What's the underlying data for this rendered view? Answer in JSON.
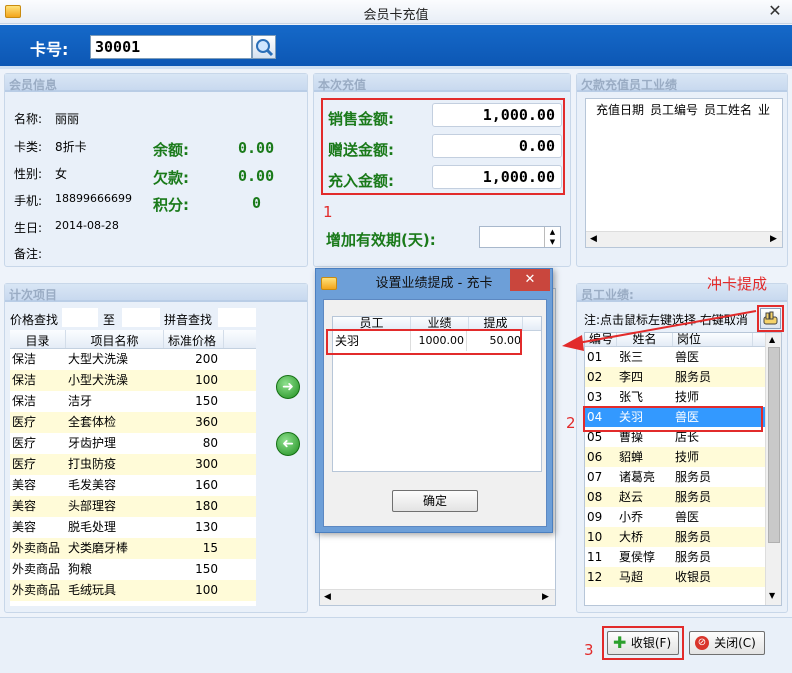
{
  "window": {
    "title": "会员卡充值",
    "close": "✕"
  },
  "card": {
    "label": "卡号:",
    "value": "30001"
  },
  "member": {
    "section": "会员信息",
    "name_label": "名称:",
    "name": "丽丽",
    "type_label": "卡类:",
    "type": "8折卡",
    "gender_label": "性别:",
    "gender": "女",
    "phone_label": "手机:",
    "phone": "18899666699",
    "birth_label": "生日:",
    "birth": "2014-08-28",
    "note_label": "备注:",
    "balance_label": "余额:",
    "balance": "0.00",
    "debt_label": "欠款:",
    "debt": "0.00",
    "points_label": "积分:",
    "points": "0"
  },
  "recharge": {
    "section": "本次充值",
    "sale_label": "销售金额:",
    "sale": "1,000.00",
    "gift_label": "赠送金额:",
    "gift": "0.00",
    "charge_label": "充入金额:",
    "charge": "1,000.00",
    "annot1": "1",
    "extend_label": "增加有效期(天):"
  },
  "debt_staff": {
    "section": "欠款充值员工业绩",
    "headers": [
      "充值日期",
      "员工编号",
      "员工姓名",
      "业"
    ]
  },
  "items": {
    "section": "计次项目",
    "price_search": "价格查找",
    "to": "至",
    "pinyin_search": "拼音查找",
    "headers": [
      "目录",
      "项目名称",
      "标准价格"
    ],
    "rows": [
      [
        "保洁",
        "大型犬洗澡",
        "200"
      ],
      [
        "保洁",
        "小型犬洗澡",
        "100"
      ],
      [
        "保洁",
        "洁牙",
        "150"
      ],
      [
        "医疗",
        "全套体检",
        "360"
      ],
      [
        "医疗",
        "牙齿护理",
        "80"
      ],
      [
        "医疗",
        "打虫防疫",
        "300"
      ],
      [
        "美容",
        "毛发美容",
        "160"
      ],
      [
        "美容",
        "头部理容",
        "180"
      ],
      [
        "美容",
        "脱毛处理",
        "130"
      ],
      [
        "外卖商品",
        "犬类磨牙棒",
        "15"
      ],
      [
        "外卖商品",
        "狗粮",
        "150"
      ],
      [
        "外卖商品",
        "毛绒玩具",
        "100"
      ]
    ]
  },
  "dialog": {
    "title": "设置业绩提成 - 充卡",
    "close": "✕",
    "headers": [
      "员工",
      "业绩",
      "提成"
    ],
    "row": [
      "关羽",
      "1000.00",
      "50.00"
    ],
    "ok": "确定"
  },
  "staff": {
    "section": "员工业绩:",
    "annot_top": "冲卡提成",
    "hint": "注:点击鼠标左键选择 右键取消",
    "headers": [
      "编号",
      "姓名",
      "岗位"
    ],
    "rows": [
      [
        "01",
        "张三",
        "兽医"
      ],
      [
        "02",
        "李四",
        "服务员"
      ],
      [
        "03",
        "张飞",
        "技师"
      ],
      [
        "04",
        "关羽",
        "兽医"
      ],
      [
        "05",
        "曹操",
        "店长"
      ],
      [
        "06",
        "貂蝉",
        "技师"
      ],
      [
        "07",
        "诸葛亮",
        "服务员"
      ],
      [
        "08",
        "赵云",
        "服务员"
      ],
      [
        "09",
        "小乔",
        "兽医"
      ],
      [
        "10",
        "大桥",
        "服务员"
      ],
      [
        "11",
        "夏侯惇",
        "服务员"
      ],
      [
        "12",
        "马超",
        "收银员"
      ]
    ],
    "annot2": "2"
  },
  "footer": {
    "annot3": "3",
    "checkout": "收银(F)",
    "close": "关闭(C)"
  },
  "colors": {
    "accent": "#0d57b4",
    "annotation": "#e22b2b",
    "selected": "#3399ff",
    "money_green": "#1a7a1a"
  }
}
